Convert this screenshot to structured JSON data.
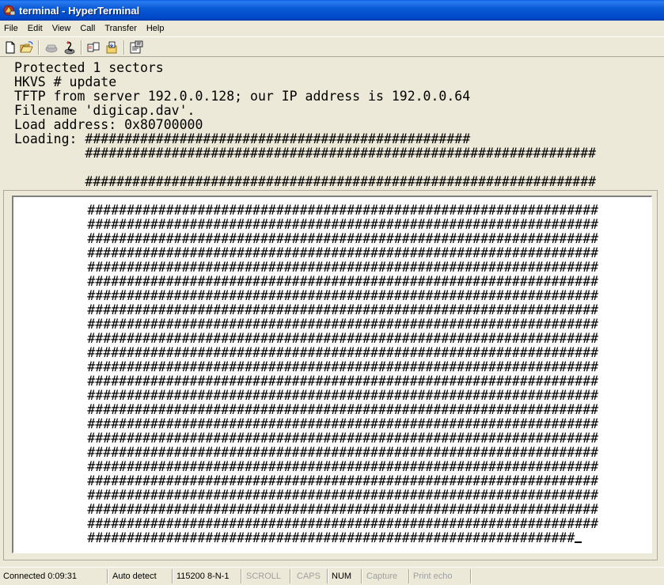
{
  "window": {
    "title": "terminal - HyperTerminal"
  },
  "menu": [
    "File",
    "Edit",
    "View",
    "Call",
    "Transfer",
    "Help"
  ],
  "toolbar": {
    "icons": [
      "new-connection-icon",
      "open-icon",
      "disconnect-icon",
      "dial-icon",
      "send-icon",
      "receive-icon",
      "properties-icon"
    ]
  },
  "terminal": {
    "scrolled_lines": [
      "Protected 1 sectors",
      "HKVS # update",
      "TFTP from server 192.0.0.128; our IP address is 192.0.0.64",
      "Filename 'digicap.dav'.",
      "Load address: 0x80700000",
      "Loading: #################################################",
      "         #################################################################",
      "",
      "         #################################################################"
    ],
    "live_lines": [
      "         #################################################################",
      "         #################################################################",
      "         #################################################################",
      "         #################################################################",
      "         #################################################################",
      "         #################################################################",
      "         #################################################################",
      "         #################################################################",
      "         #################################################################",
      "         #################################################################",
      "         #################################################################",
      "         #################################################################",
      "         #################################################################",
      "         #################################################################",
      "         #################################################################",
      "         #################################################################",
      "         #################################################################",
      "         #################################################################",
      "         #################################################################",
      "         #################################################################",
      "         #################################################################",
      "         #################################################################",
      "         #################################################################",
      "         ##############################################################"
    ]
  },
  "status": {
    "connected": "Connected 0:09:31",
    "detect": "Auto detect",
    "port": "115200 8-N-1",
    "scroll": "SCROLL",
    "caps": "CAPS",
    "num": "NUM",
    "capture": "Capture",
    "print_echo": "Print echo"
  }
}
